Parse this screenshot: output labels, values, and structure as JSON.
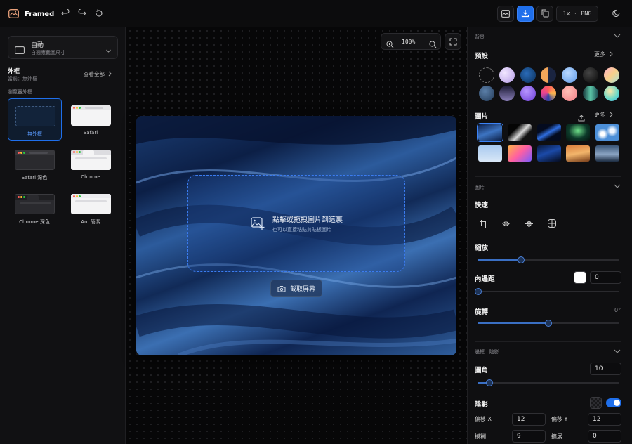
{
  "app": {
    "title": "Framed"
  },
  "toolbar": {
    "export_format": "1x · PNG"
  },
  "sidebar": {
    "size_select": {
      "title": "自動",
      "subtitle": "自適應截圖尺寸"
    },
    "frame_section": {
      "title": "外框",
      "current": "當前：無外框",
      "view_all": "查看全部"
    },
    "browser_label": "瀏覽器外框",
    "frames": [
      {
        "label": "無外框"
      },
      {
        "label": "Safari"
      },
      {
        "label": "Safari 深色"
      },
      {
        "label": "Chrome"
      },
      {
        "label": "Chrome 深色"
      },
      {
        "label": "Arc 簡潔"
      }
    ]
  },
  "canvas": {
    "zoom": "100%",
    "drop_title": "點擊或拖拽圖片到這裏",
    "drop_sub": "也可以直接粘貼剪貼板圖片",
    "capture_label": "截取屏幕"
  },
  "panel": {
    "bg_section": "背景",
    "preset_title": "預設",
    "more": "更多",
    "images_title": "圖片",
    "image_section": "圖片",
    "quick_title": "快速",
    "scale_title": "縮放",
    "scale_value": 0.33,
    "padding_title": "內邊距",
    "padding_value": "0",
    "rotate_title": "旋轉",
    "rotate_value": "0°",
    "border_section": "邊框 · 陰影",
    "radius_title": "圓角",
    "radius_value": "10",
    "shadow_title": "陰影",
    "offset_x_label": "偏移 X",
    "offset_x_value": "12",
    "offset_y_label": "偏移 Y",
    "offset_y_value": "12",
    "blur_label": "模糊",
    "blur_value": "9",
    "spread_label": "擴展",
    "spread_value": "0"
  },
  "colors": {
    "accent": "#1f6feb"
  }
}
